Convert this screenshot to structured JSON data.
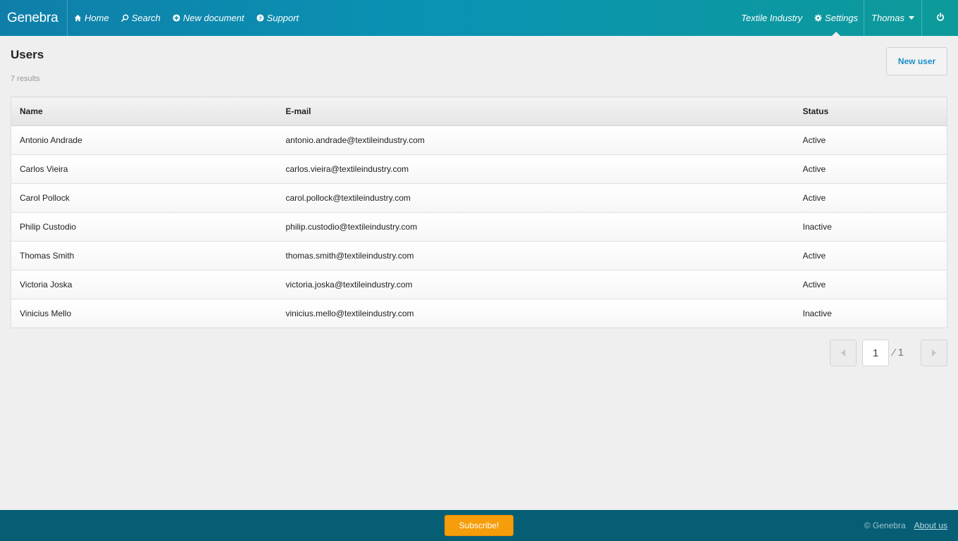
{
  "navbar": {
    "brand": "Genebra",
    "left_items": [
      {
        "label": "Home",
        "icon": "home-icon"
      },
      {
        "label": "Search",
        "icon": "search-icon"
      },
      {
        "label": "New document",
        "icon": "plus-circle-icon"
      },
      {
        "label": "Support",
        "icon": "question-circle-icon"
      }
    ],
    "organization": "Textile Industry",
    "settings_label": "Settings",
    "user_name": "Thomas",
    "power_icon": "power-icon"
  },
  "page": {
    "title": "Users",
    "results": "7 results",
    "new_user_label": "New user"
  },
  "table": {
    "headers": [
      "Name",
      "E-mail",
      "Status"
    ],
    "rows": [
      {
        "name": "Antonio Andrade",
        "email": "antonio.andrade@textileindustry.com",
        "status": "Active"
      },
      {
        "name": "Carlos Vieira",
        "email": "carlos.vieira@textileindustry.com",
        "status": "Active"
      },
      {
        "name": "Carol Pollock",
        "email": "carol.pollock@textileindustry.com",
        "status": "Active"
      },
      {
        "name": "Philip Custodio",
        "email": "philip.custodio@textileindustry.com",
        "status": "Inactive"
      },
      {
        "name": "Thomas Smith",
        "email": "thomas.smith@textileindustry.com",
        "status": "Active"
      },
      {
        "name": "Victoria Joska",
        "email": "victoria.joska@textileindustry.com",
        "status": "Active"
      },
      {
        "name": "Vinicius Mello",
        "email": "vinicius.mello@textileindustry.com",
        "status": "Inactive"
      }
    ]
  },
  "pagination": {
    "current_page": "1",
    "total_label": "⁄ 1"
  },
  "footer": {
    "subscribe_label": "Subscribe!",
    "copyright": "© Genebra",
    "about_label": "About us"
  },
  "colors": {
    "navbar_start": "#0f7fa9",
    "navbar_end": "#0d9a9a",
    "accent_link": "#1a8fc9",
    "subscribe": "#f59d0a",
    "footer": "#065e74"
  }
}
